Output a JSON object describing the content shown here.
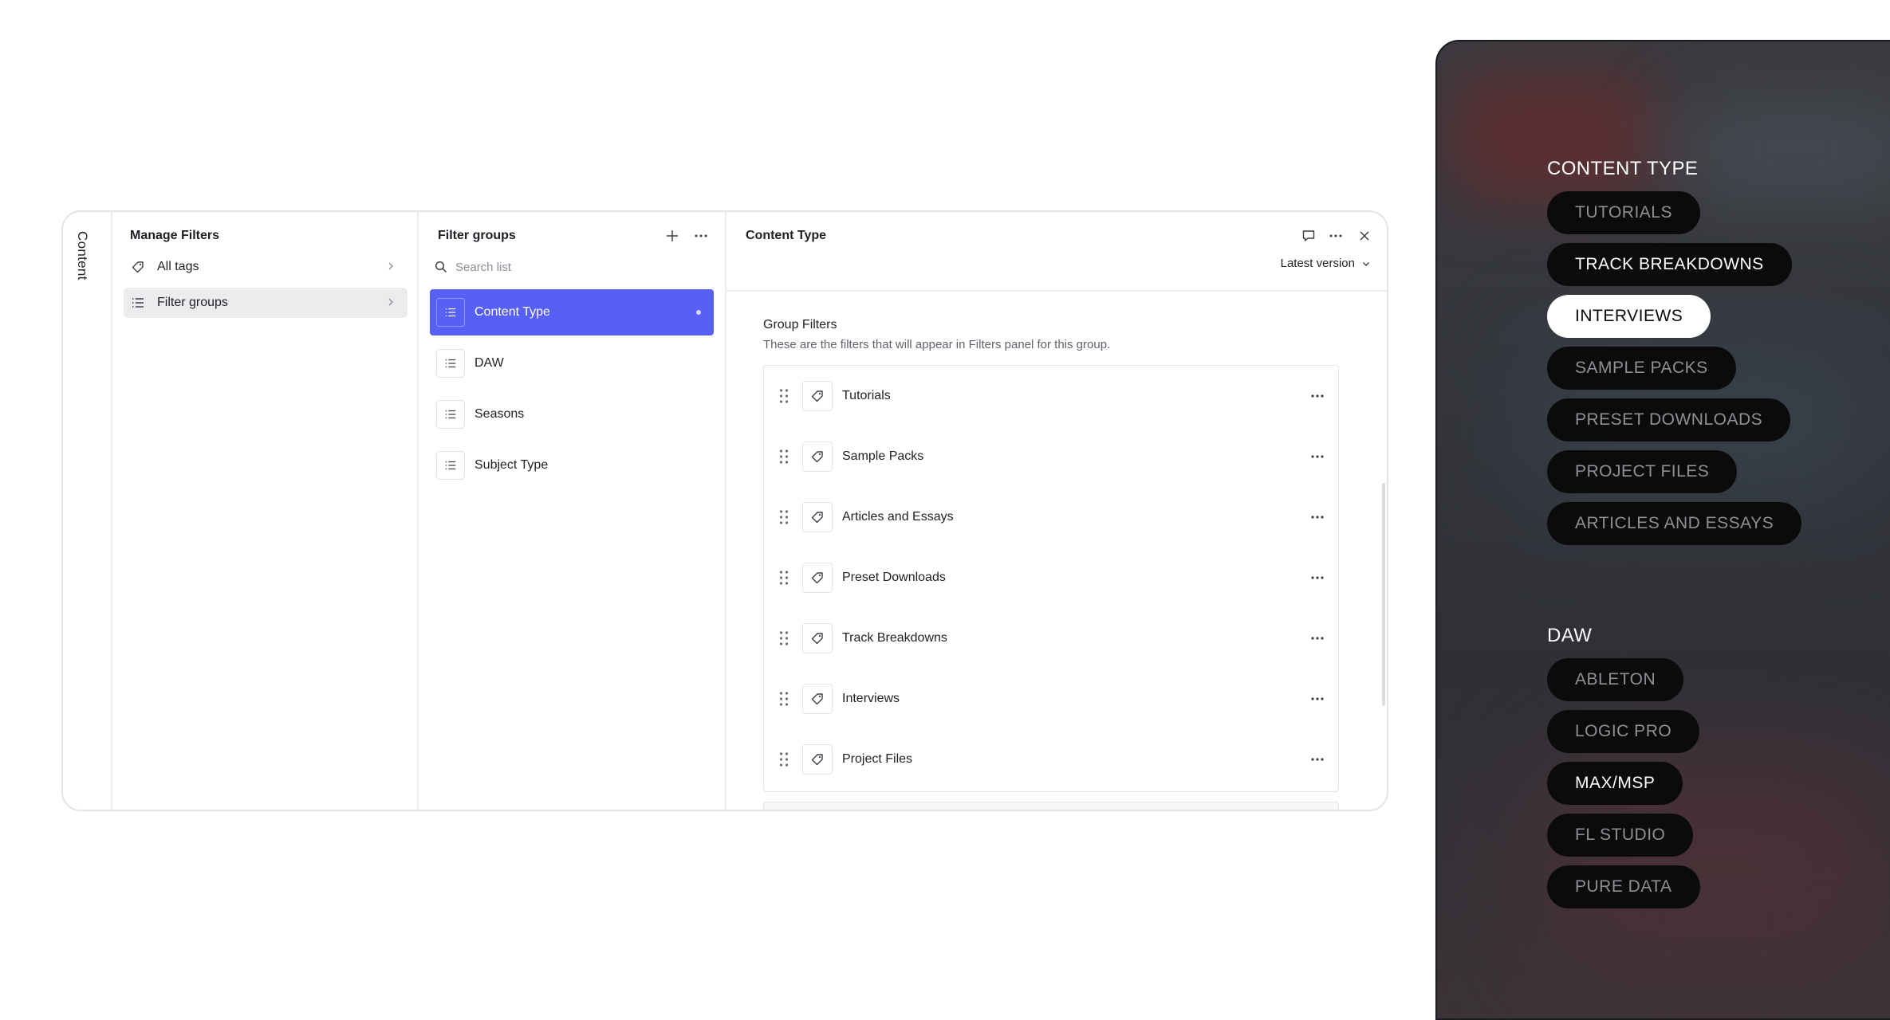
{
  "sidebar_rail": {
    "label": "Content"
  },
  "manage": {
    "title": "Manage Filters",
    "items": [
      {
        "label": "All tags",
        "icon": "tag-icon",
        "active": false
      },
      {
        "label": "Filter groups",
        "icon": "list-icon",
        "active": true
      }
    ]
  },
  "groups": {
    "title": "Filter groups",
    "search_placeholder": "Search list",
    "items": [
      {
        "label": "Content Type",
        "active": true
      },
      {
        "label": "DAW",
        "active": false
      },
      {
        "label": "Seasons",
        "active": false
      },
      {
        "label": "Subject Type",
        "active": false
      }
    ]
  },
  "detail": {
    "title": "Content Type",
    "version": "Latest version",
    "section_title": "Group Filters",
    "section_desc": "These are the filters that will appear in Filters panel for this group.",
    "filters": [
      "Tutorials",
      "Sample Packs",
      "Articles and Essays",
      "Preset Downloads",
      "Track Breakdowns",
      "Interviews",
      "Project Files"
    ]
  },
  "preview": {
    "groups": [
      {
        "title": "CONTENT TYPE",
        "pills": [
          {
            "label": "TUTORIALS",
            "state": "off"
          },
          {
            "label": "TRACK BREAKDOWNS",
            "state": "on"
          },
          {
            "label": "INTERVIEWS",
            "state": "selected"
          },
          {
            "label": "SAMPLE PACKS",
            "state": "off"
          },
          {
            "label": "PRESET DOWNLOADS",
            "state": "off"
          },
          {
            "label": "PROJECT FILES",
            "state": "off"
          },
          {
            "label": "ARTICLES AND ESSAYS",
            "state": "off"
          }
        ]
      },
      {
        "title": "DAW",
        "pills": [
          {
            "label": "ABLETON",
            "state": "off"
          },
          {
            "label": "LOGIC PRO",
            "state": "off"
          },
          {
            "label": "MAX/MSP",
            "state": "on"
          },
          {
            "label": "FL STUDIO",
            "state": "off"
          },
          {
            "label": "PURE DATA",
            "state": "off"
          }
        ]
      }
    ]
  },
  "colors": {
    "accent": "#5660f5",
    "pill_bg": "#0b0b0c",
    "pill_selected_bg": "#ffffff"
  }
}
